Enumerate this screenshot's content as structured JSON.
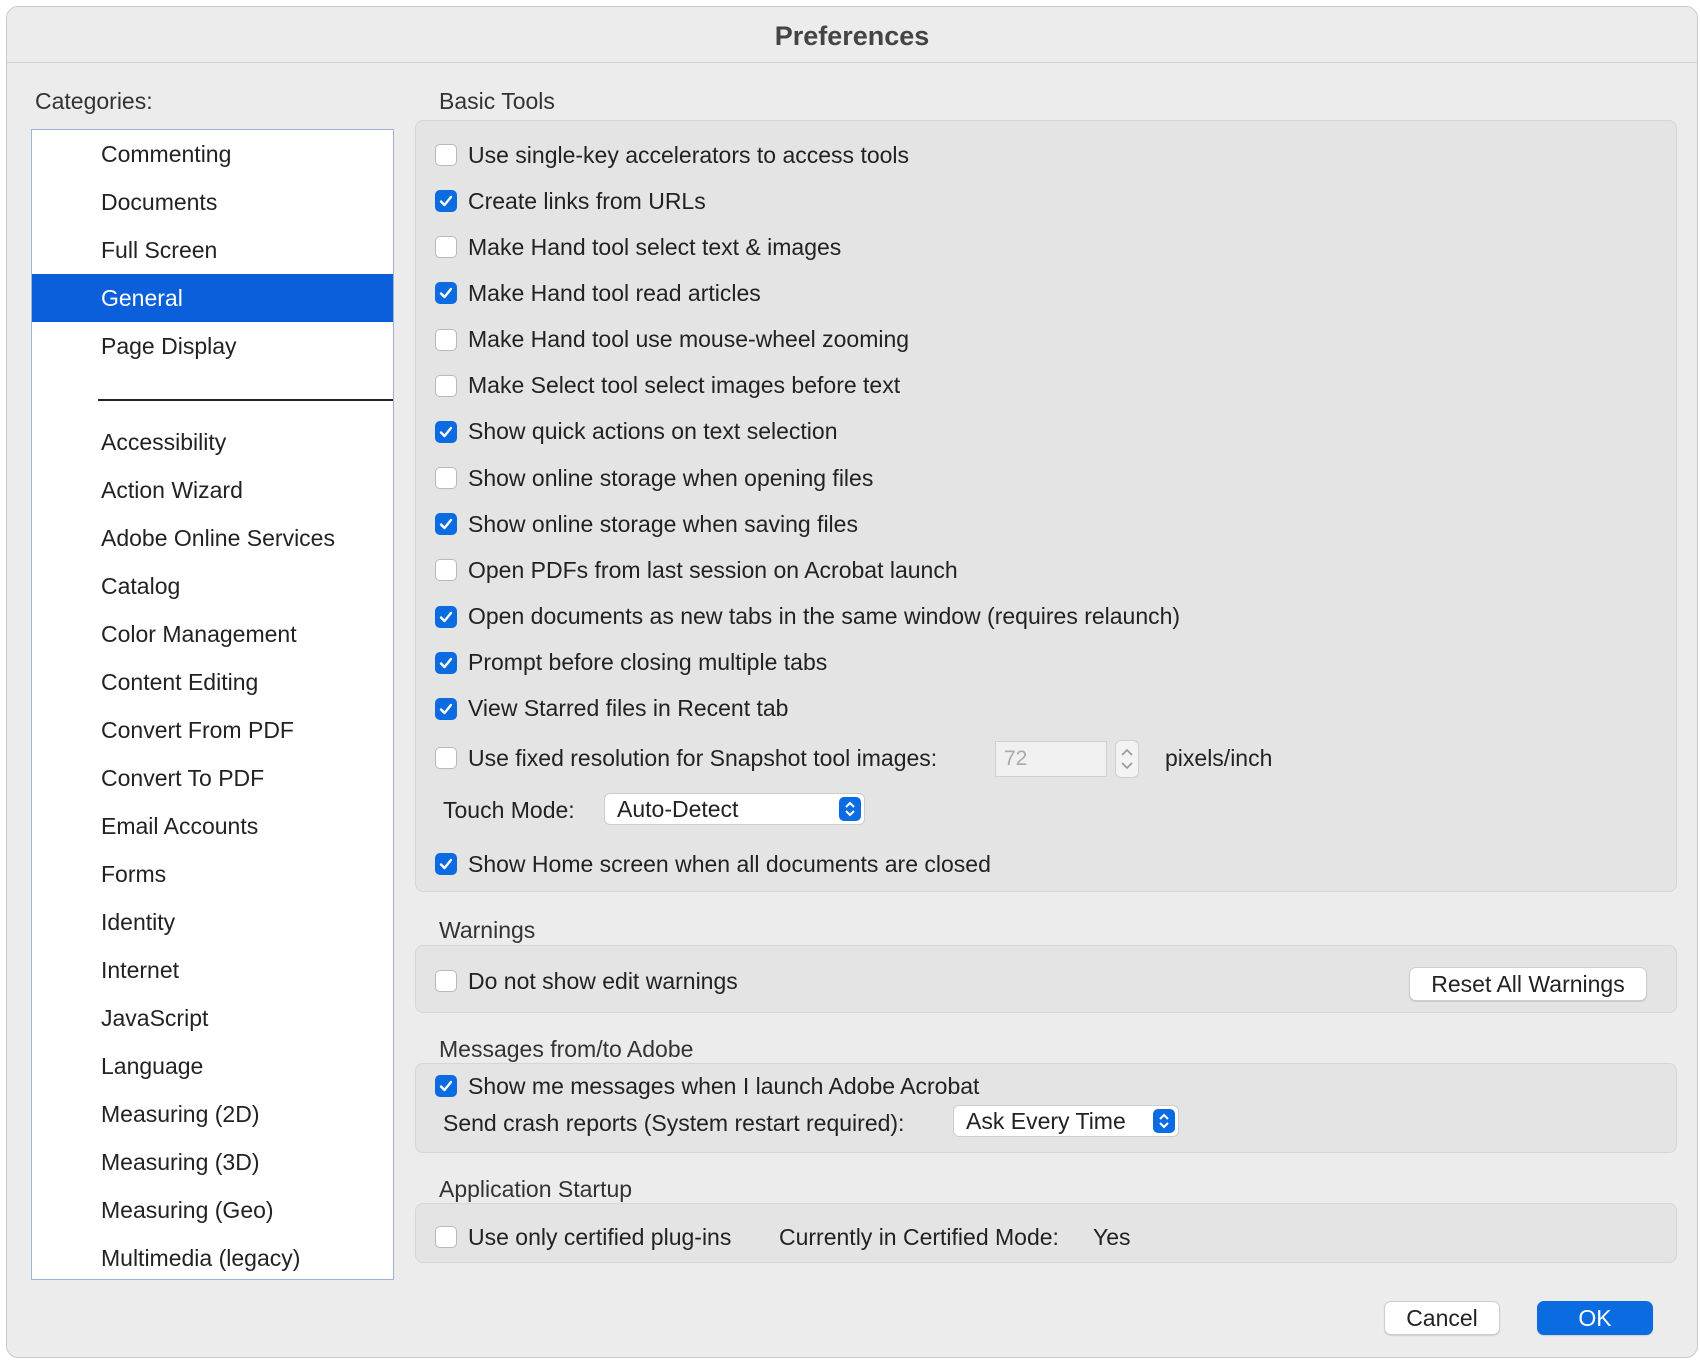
{
  "window": {
    "title": "Preferences"
  },
  "sidebar": {
    "label": "Categories:",
    "top_items": [
      "Commenting",
      "Documents",
      "Full Screen",
      "General",
      "Page Display"
    ],
    "selected": "General",
    "bottom_items": [
      "Accessibility",
      "Action Wizard",
      "Adobe Online Services",
      "Catalog",
      "Color Management",
      "Content Editing",
      "Convert From PDF",
      "Convert To PDF",
      "Email Accounts",
      "Forms",
      "Identity",
      "Internet",
      "JavaScript",
      "Language",
      "Measuring (2D)",
      "Measuring (3D)",
      "Measuring (Geo)",
      "Multimedia (legacy)"
    ]
  },
  "basic_tools": {
    "title": "Basic Tools",
    "options": [
      {
        "label": "Use single-key accelerators to access tools",
        "checked": false
      },
      {
        "label": "Create links from URLs",
        "checked": true
      },
      {
        "label": "Make Hand tool select text & images",
        "checked": false
      },
      {
        "label": "Make Hand tool read articles",
        "checked": true
      },
      {
        "label": "Make Hand tool use mouse-wheel zooming",
        "checked": false
      },
      {
        "label": "Make Select tool select images before text",
        "checked": false
      },
      {
        "label": "Show quick actions on text selection",
        "checked": true
      },
      {
        "label": "Show online storage when opening files",
        "checked": false
      },
      {
        "label": "Show online storage when saving files",
        "checked": true
      },
      {
        "label": "Open PDFs from last session on Acrobat launch",
        "checked": false
      },
      {
        "label": "Open documents as new tabs in the same window (requires relaunch)",
        "checked": true
      },
      {
        "label": "Prompt before closing multiple tabs",
        "checked": true
      },
      {
        "label": "View Starred files in Recent tab",
        "checked": true
      }
    ],
    "snapshot": {
      "label": "Use fixed resolution for Snapshot tool images:",
      "checked": false,
      "value": "72",
      "unit": "pixels/inch"
    },
    "touch_mode": {
      "label": "Touch Mode:",
      "value": "Auto-Detect"
    },
    "home_screen": {
      "label": "Show Home screen when all documents are closed",
      "checked": true
    }
  },
  "warnings": {
    "title": "Warnings",
    "option": {
      "label": "Do not show edit warnings",
      "checked": false
    },
    "reset_button": "Reset All Warnings"
  },
  "messages": {
    "title": "Messages from/to Adobe",
    "option": {
      "label": "Show me messages when I launch Adobe Acrobat",
      "checked": true
    },
    "crash_label": "Send crash reports (System restart required):",
    "crash_value": "Ask Every Time"
  },
  "startup": {
    "title": "Application Startup",
    "option": {
      "label": "Use only certified plug-ins",
      "checked": false
    },
    "mode_label": "Currently in Certified Mode:",
    "mode_value": "Yes"
  },
  "footer": {
    "cancel": "Cancel",
    "ok": "OK"
  },
  "colors": {
    "accent": "#0b6be0",
    "selection": "#0b5fdb"
  }
}
